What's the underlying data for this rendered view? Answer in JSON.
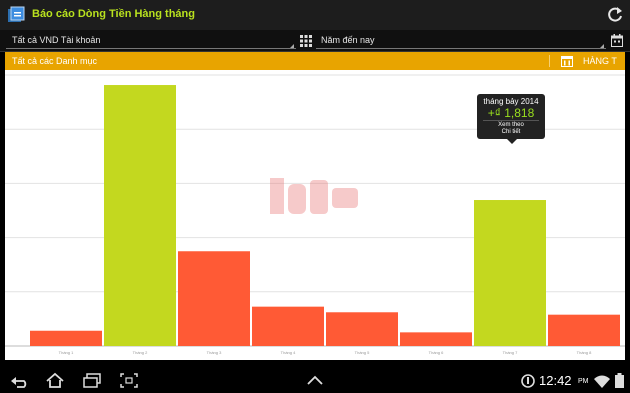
{
  "app": {
    "title": "Báo cáo Dòng Tiền Hàng tháng",
    "icons": {
      "app": "report-icon",
      "refresh": "refresh-icon"
    }
  },
  "filters": {
    "account": "Tất cả VND Tài khoản",
    "period": "Năm đến nay",
    "icons": {
      "account": "grid-icon",
      "period": "calendar-icon"
    }
  },
  "category_bar": {
    "label": "Tất cả các Danh mục",
    "period_label": "HÀNG T",
    "icon": "calendar-icon",
    "color": "#e8a400"
  },
  "tooltip": {
    "month": "tháng bảy 2014",
    "amount": "+₫ 1,818",
    "detail_line1": "Xem theo",
    "detail_line2": "Chi tiết"
  },
  "chart_data": {
    "type": "bar",
    "categories": [
      "Tháng 1",
      "Tháng 2",
      "Tháng 3",
      "Tháng 4",
      "Tháng 5",
      "Tháng 6",
      "Tháng 7",
      "Tháng 8"
    ],
    "values": [
      190,
      3250,
      1180,
      490,
      420,
      170,
      1818,
      390
    ],
    "colors": [
      "#ff5a35",
      "#c3d81f",
      "#ff5a35",
      "#ff5a35",
      "#ff5a35",
      "#ff5a35",
      "#c3d81f",
      "#ff5a35"
    ],
    "ylim": [
      0,
      3375
    ],
    "gridlines": [
      675,
      1350,
      2025,
      2700,
      3375
    ],
    "grid": true
  },
  "navigation": {
    "time": "12:42",
    "ampm": "PM",
    "icons": [
      "back-icon",
      "home-icon",
      "recent-apps-icon",
      "screenshot-icon",
      "up-chevron-icon",
      "sync-status-icon",
      "wifi-icon",
      "battery-icon"
    ]
  }
}
